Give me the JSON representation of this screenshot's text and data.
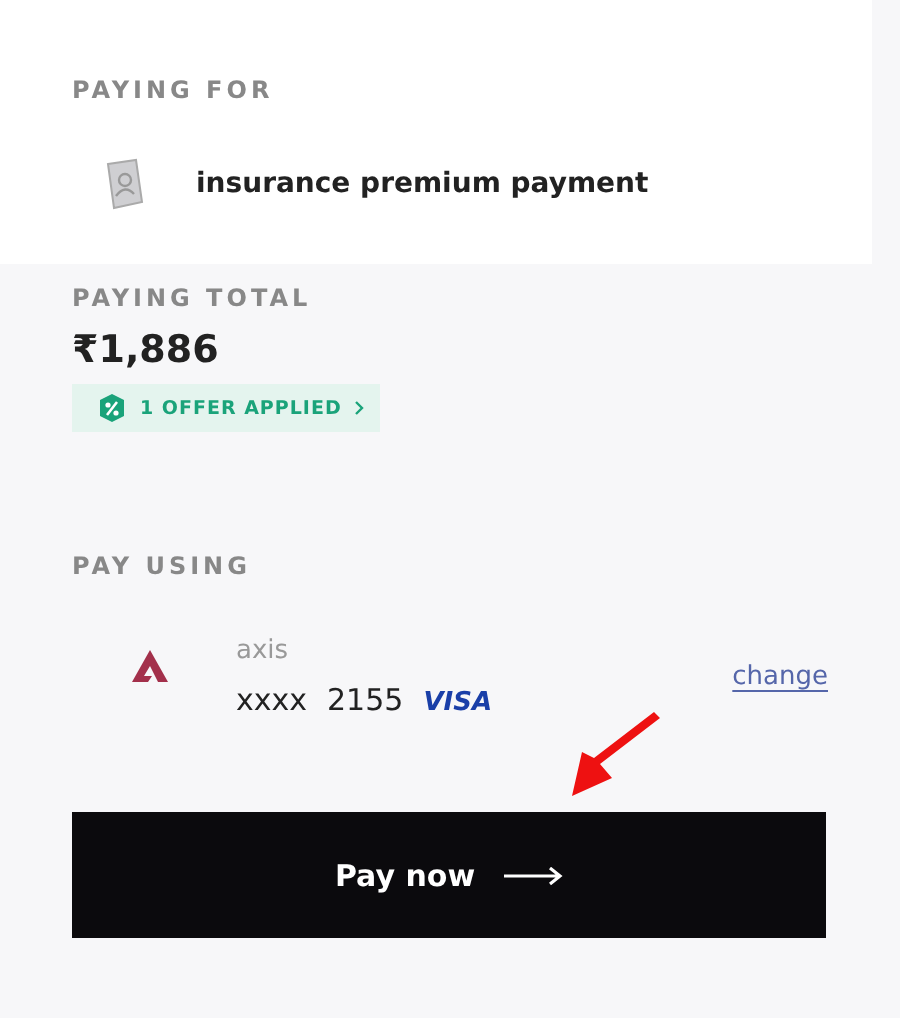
{
  "paying_for": {
    "label": "PAYING FOR",
    "item": "insurance premium payment"
  },
  "paying_total": {
    "label": "PAYING TOTAL",
    "amount": "₹1,886",
    "offer": "1 OFFER APPLIED"
  },
  "pay_using": {
    "label": "PAY USING",
    "bank": "axis",
    "card_mask": "xxxx",
    "card_last4": "2155",
    "network": "VISA",
    "change": "change"
  },
  "button": {
    "label": "Pay now"
  }
}
